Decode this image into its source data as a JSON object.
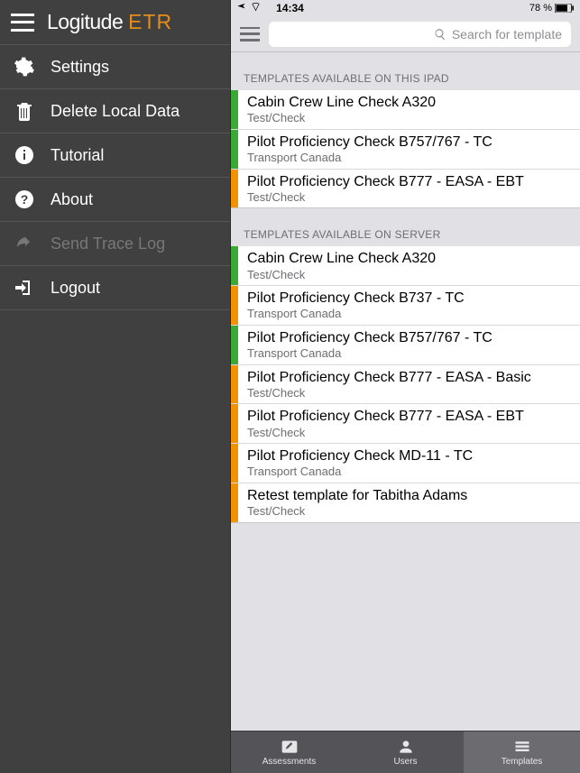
{
  "statusbar": {
    "time": "14:34",
    "battery": "78 %"
  },
  "brand": {
    "name": "Logitude",
    "suffix": "ETR"
  },
  "menu": [
    {
      "id": "settings",
      "label": "Settings",
      "icon": "gear",
      "disabled": false
    },
    {
      "id": "delete",
      "label": "Delete Local Data",
      "icon": "trash",
      "disabled": false
    },
    {
      "id": "tutorial",
      "label": "Tutorial",
      "icon": "info",
      "disabled": false
    },
    {
      "id": "about",
      "label": "About",
      "icon": "help",
      "disabled": false
    },
    {
      "id": "trace",
      "label": "Send Trace Log",
      "icon": "share",
      "disabled": true
    },
    {
      "id": "logout",
      "label": "Logout",
      "icon": "logout",
      "disabled": false
    }
  ],
  "search": {
    "placeholder": "Search for template"
  },
  "sections": [
    {
      "header": "TEMPLATES AVAILABLE ON THIS IPAD",
      "rows": [
        {
          "color": "green",
          "title": "Cabin Crew Line Check A320",
          "sub": "Test/Check"
        },
        {
          "color": "green",
          "title": "Pilot Proficiency Check B757/767 - TC",
          "sub": "Transport Canada"
        },
        {
          "color": "orange",
          "title": "Pilot Proficiency Check B777 - EASA - EBT",
          "sub": "Test/Check"
        }
      ]
    },
    {
      "header": "TEMPLATES AVAILABLE ON SERVER",
      "rows": [
        {
          "color": "green",
          "title": "Cabin Crew Line Check A320",
          "sub": "Test/Check"
        },
        {
          "color": "orange",
          "title": "Pilot Proficiency Check B737 - TC",
          "sub": "Transport Canada"
        },
        {
          "color": "green",
          "title": "Pilot Proficiency Check B757/767 - TC",
          "sub": "Transport Canada"
        },
        {
          "color": "orange",
          "title": "Pilot Proficiency Check B777 - EASA - Basic",
          "sub": "Test/Check"
        },
        {
          "color": "orange",
          "title": "Pilot Proficiency Check B777 - EASA - EBT",
          "sub": "Test/Check"
        },
        {
          "color": "orange",
          "title": "Pilot Proficiency Check MD-11 - TC",
          "sub": "Transport Canada"
        },
        {
          "color": "orange",
          "title": "Retest template for Tabitha Adams",
          "sub": "Test/Check"
        }
      ]
    }
  ],
  "tabs": [
    {
      "id": "assessments",
      "label": "Assessments",
      "icon": "pencil"
    },
    {
      "id": "users",
      "label": "Users",
      "icon": "user"
    },
    {
      "id": "templates",
      "label": "Templates",
      "icon": "stack",
      "active": true
    }
  ]
}
